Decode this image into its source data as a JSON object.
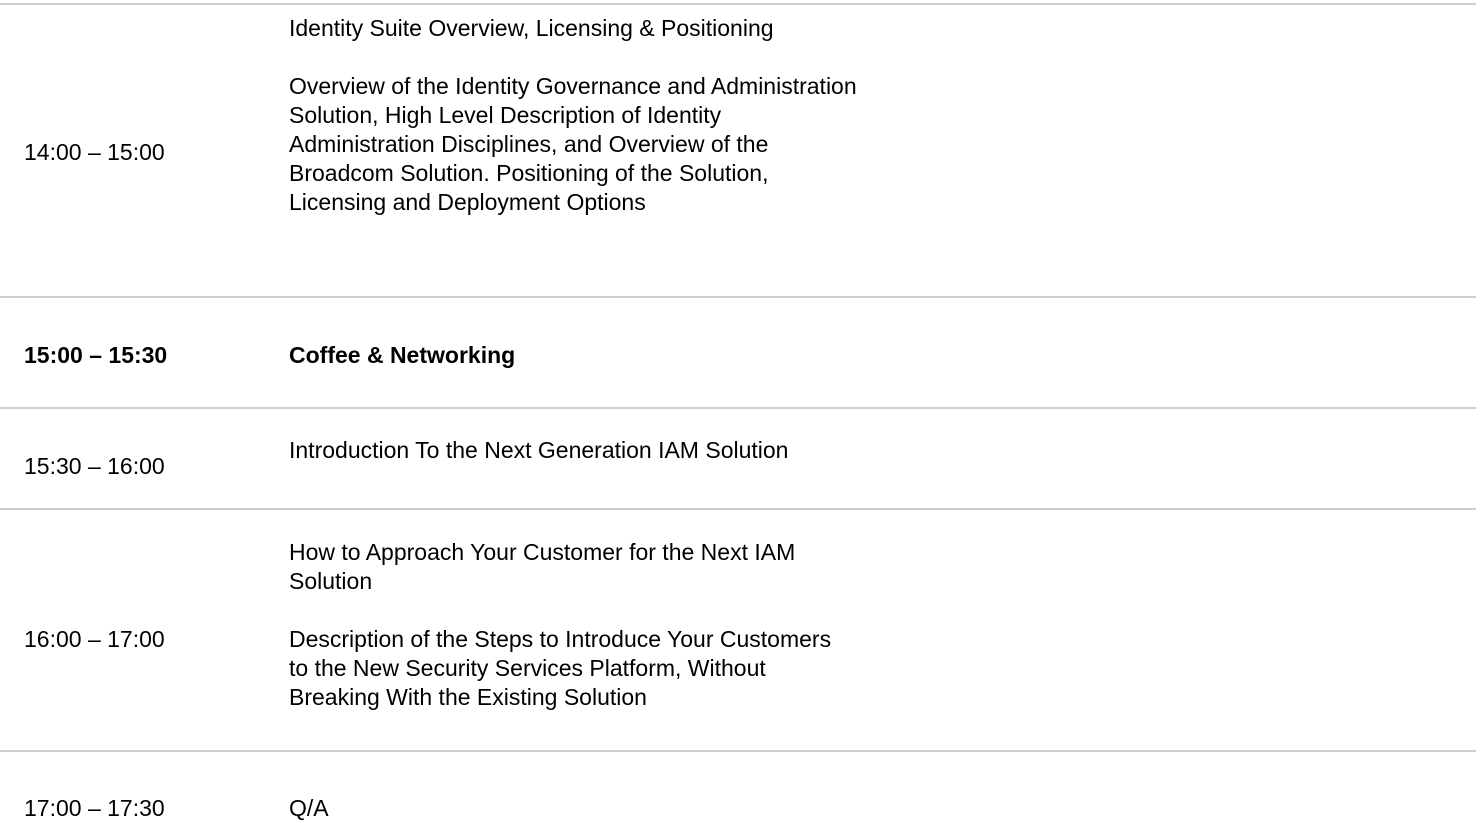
{
  "agenda": {
    "rows": [
      {
        "time": "14:00 – 15:00",
        "title": "Identity Suite Overview, Licensing & Positioning",
        "description": "Overview of the Identity Governance and Administration Solution, High Level Description of Identity Administration Disciplines, and Overview of the Broadcom Solution. Positioning of the Solution, Licensing and Deployment Options"
      },
      {
        "time": "15:00 – 15:30",
        "title": "Coffee & Networking"
      },
      {
        "time": "15:30 – 16:00",
        "title": "Introduction To the Next Generation IAM Solution"
      },
      {
        "time": "16:00 – 17:00",
        "title": "How to Approach Your Customer for the Next IAM Solution",
        "description": "Description of the Steps to Introduce Your Customers to the New Security Services Platform, Without Breaking With the Existing Solution"
      },
      {
        "time": "17:00 – 17:30",
        "title": "Q/A"
      }
    ]
  }
}
